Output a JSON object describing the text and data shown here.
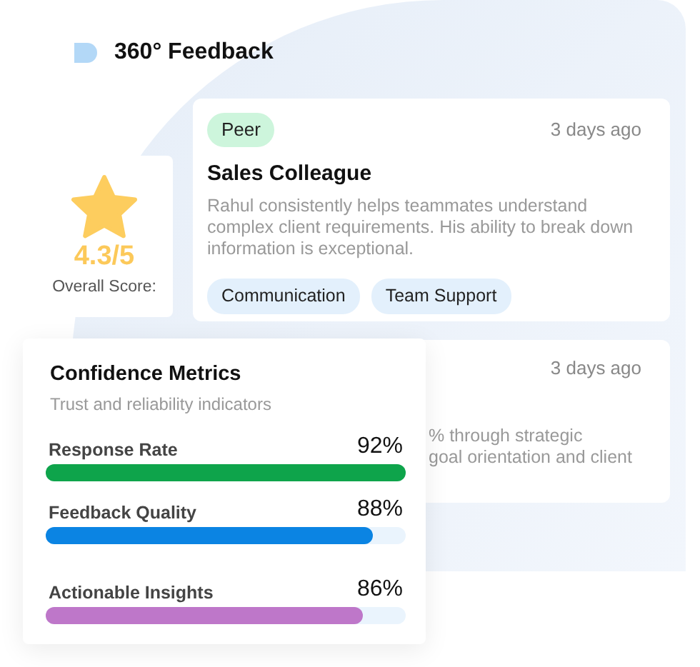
{
  "header": {
    "title": "360° Feedback"
  },
  "feedback": [
    {
      "tag": "Peer",
      "time": "3 days ago",
      "title": "Sales Colleague",
      "text": "Rahul consistently helps teammates understand complex client requirements. His ability to break down information is exceptional.",
      "skills": [
        "Communication",
        "Team Support"
      ]
    },
    {
      "time": "3 days ago",
      "text_lines": [
        "% through strategic",
        "goal orientation and client"
      ]
    }
  ],
  "score": {
    "value": "4.3/5",
    "label": "Overall Score:"
  },
  "metrics": {
    "title": "Confidence Metrics",
    "subtitle": "Trust and reliability indicators",
    "items": [
      {
        "name": "Response Rate",
        "reading": "92%",
        "level": 1.0,
        "color": "#0ea44b"
      },
      {
        "name": "Feedback Quality",
        "reading": "88%",
        "level": 0.91,
        "color": "#0b84e3"
      },
      {
        "name": "Actionable Insights",
        "reading": "86%",
        "level": 0.88,
        "color": "#be77c9"
      }
    ]
  }
}
